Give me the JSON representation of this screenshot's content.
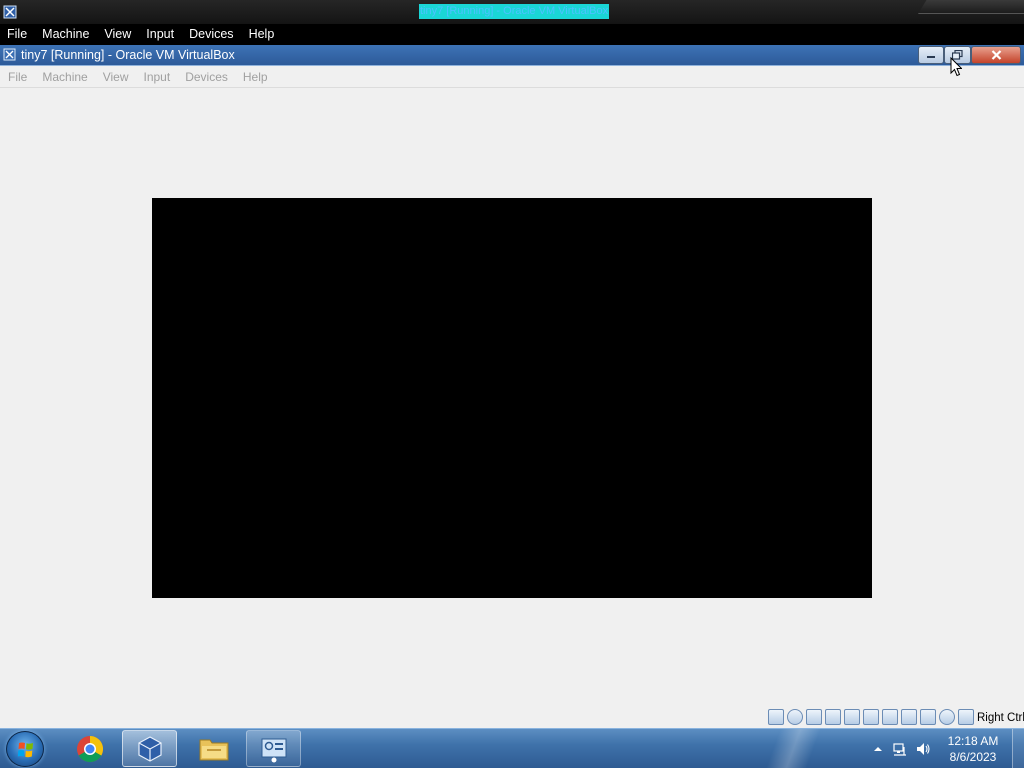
{
  "host_window": {
    "title": "tiny7 [Running] - Oracle VM VirtualBox",
    "menu": [
      "File",
      "Machine",
      "View",
      "Input",
      "Devices",
      "Help"
    ]
  },
  "vm_window": {
    "title": "tiny7 [Running] - Oracle VM VirtualBox",
    "menu": [
      "File",
      "Machine",
      "View",
      "Input",
      "Devices",
      "Help"
    ],
    "menu_state": "disabled",
    "screen_color": "#000000",
    "status_icons": [
      "hard-disk",
      "optical-drive",
      "audio",
      "network",
      "usb",
      "shared-folders",
      "display",
      "video-capture",
      "recording",
      "mouse-integration",
      "keyboard",
      "host-key-arrow"
    ],
    "host_key_label": "Right Ctrl"
  },
  "taskbar": {
    "pinned": [
      {
        "name": "chrome",
        "state": "pinned"
      },
      {
        "name": "virtualbox",
        "state": "active"
      },
      {
        "name": "windows-explorer",
        "state": "pinned"
      },
      {
        "name": "control-panel",
        "state": "open"
      }
    ],
    "tray_icons": [
      "show-hidden-icons",
      "network",
      "volume"
    ],
    "clock": {
      "time": "12:18 AM",
      "date": "8/6/2023"
    }
  },
  "colors": {
    "titlebar_blue": "#3d73b6",
    "taskbar_blue": "#3f72aa",
    "host_title_highlight": "#1ad6d6"
  }
}
